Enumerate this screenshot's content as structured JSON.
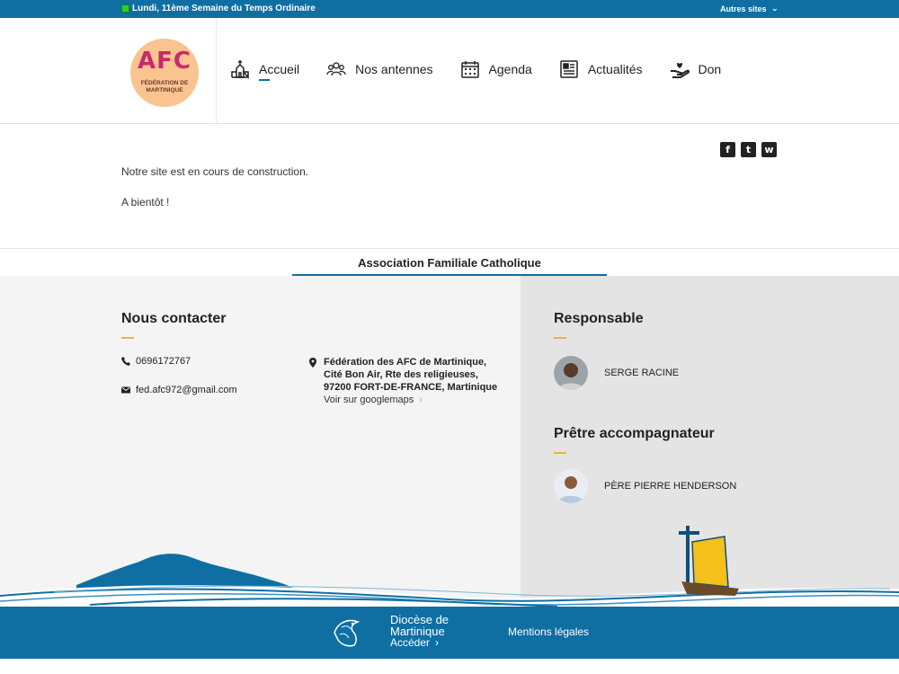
{
  "topbar": {
    "liturgy": "Lundi, 11ème Semaine du Temps Ordinaire",
    "other_sites": "Autres sites"
  },
  "logo": {
    "big": "AFC",
    "line1": "FÉDÉRATION DE",
    "line2": "MARTINIQUE"
  },
  "nav": {
    "items": [
      {
        "label": "Accueil",
        "icon": "church-icon"
      },
      {
        "label": "Nos antennes",
        "icon": "people-icon"
      },
      {
        "label": "Agenda",
        "icon": "calendar-icon"
      },
      {
        "label": "Actualités",
        "icon": "newspaper-icon"
      },
      {
        "label": "Don",
        "icon": "donate-heart-hand-icon"
      }
    ]
  },
  "social": {
    "facebook": "f",
    "twitter": "t",
    "whatsapp": "w"
  },
  "main": {
    "message1": "Notre site est en cours de construction.",
    "message2": "A bientôt !"
  },
  "association": "Association Familiale Catholique",
  "contact": {
    "title": "Nous contacter",
    "phone": "0696172767",
    "email": "fed.afc972@gmail.com",
    "address_line1": "Fédération des AFC de Martinique,",
    "address_line2": "Cité Bon Air, Rte des religieuses,",
    "address_line3": "97200 FORT-DE-FRANCE, Martinique",
    "map_link": "Voir sur googlemaps"
  },
  "responsable": {
    "title": "Responsable",
    "name": "SERGE RACINE"
  },
  "pretre": {
    "title": "Prêtre accompagnateur",
    "name": "PÈRE PIERRE HENDERSON"
  },
  "footer": {
    "diocese_line1": "Diocèse de",
    "diocese_line2": "Martinique",
    "acceder": "Accéder",
    "mentions": "Mentions légales"
  },
  "colors": {
    "primary": "#0f6fa3",
    "accent": "#f0b43c",
    "logo_bg": "#f9c48f",
    "logo_text": "#c72b6a"
  }
}
